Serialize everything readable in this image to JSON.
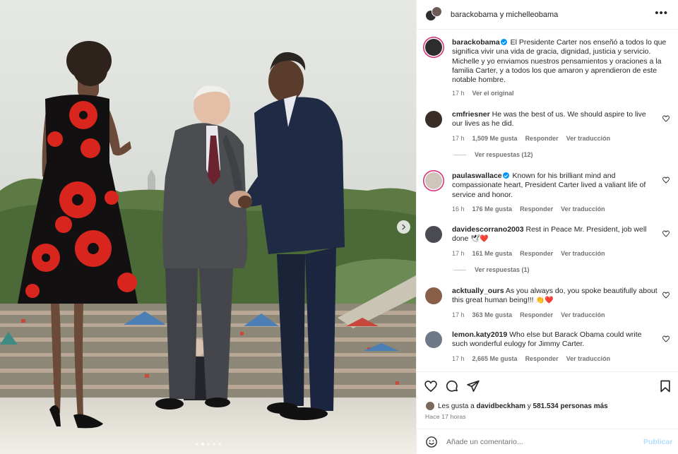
{
  "header": {
    "names": "barackobama y michelleobama"
  },
  "caption": {
    "username": "barackobama",
    "text": "El Presidente Carter nos enseñó a todos lo que significa vivir una vida de gracia, dignidad, justicia y servicio. Michelle y yo enviamos nuestros pensamientos y oraciones a la familia Carter, y a todos los que amaron y aprendieron de este notable hombre.",
    "age": "17 h",
    "see_original": "Ver el original"
  },
  "comments": [
    {
      "username": "cmfriesner",
      "text": "He was the best of us. We should aspire to live our lives as he did.",
      "age": "17 h",
      "likes": "1,509 Me gusta",
      "reply": "Responder",
      "translate": "Ver traducción",
      "view_replies": "Ver respuestas (12)"
    },
    {
      "username": "paulaswallace",
      "text": "Known for his brilliant mind and compassionate heart, President Carter lived a valiant life of service and honor.",
      "age": "16 h",
      "likes": "176 Me gusta",
      "reply": "Responder",
      "translate": "Ver traducción"
    },
    {
      "username": "davidescorrano2003",
      "text": "Rest in Peace Mr. President, job well done",
      "emoji": "🕊❤️",
      "age": "17 h",
      "likes": "161 Me gusta",
      "reply": "Responder",
      "translate": "Ver traducción",
      "view_replies": "Ver respuestas (1)"
    },
    {
      "username": "acktually_ours",
      "text": "As you always do, you spoke beautifully about this great human being!!!",
      "emoji": "👏❤️",
      "age": "17 h",
      "likes": "363 Me gusta",
      "reply": "Responder",
      "translate": "Ver traducción"
    },
    {
      "username": "lemon.katy2019",
      "text": "Who else but Barack Obama could write such wonderful eulogy for Jimmy Carter.",
      "age": "17 h",
      "likes": "2,665 Me gusta",
      "reply": "Responder",
      "translate": "Ver traducción"
    }
  ],
  "likes": {
    "prefix": "Les gusta a",
    "user": "davidbeckham",
    "joiner": "y",
    "others": "581.534 personas más"
  },
  "timestamp": "Hace 17 horas",
  "add_comment": {
    "placeholder": "Añade un comentario...",
    "publish": "Publicar"
  },
  "icons": {
    "more": "more-icon",
    "next": "chevron-right-icon",
    "like": "heart-icon",
    "comment": "comment-icon",
    "share": "send-icon",
    "save": "bookmark-icon",
    "emoji": "emoji-icon"
  },
  "colors": {
    "verified": "#0095f6",
    "muted": "#737373",
    "publish_disabled": "#b2dffc",
    "emoji_red": "#ed4956"
  }
}
